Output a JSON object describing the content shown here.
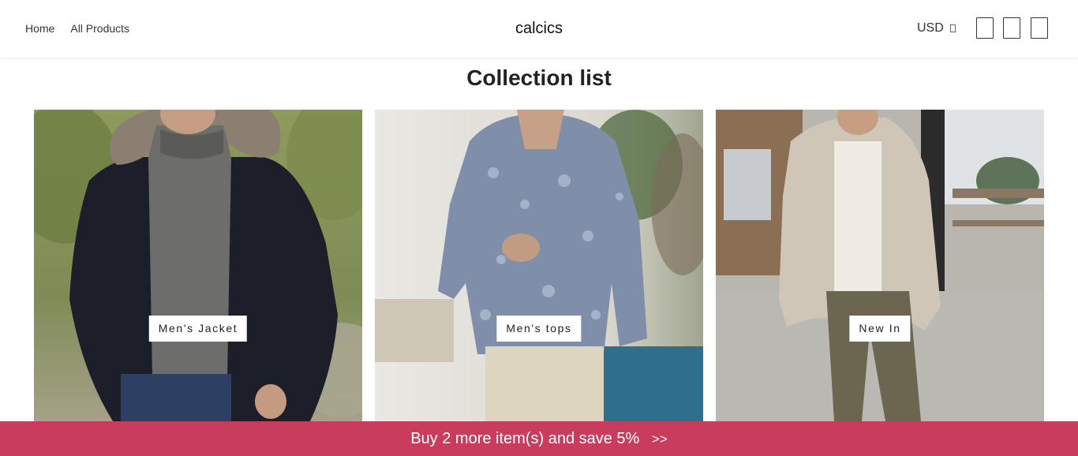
{
  "header": {
    "nav": [
      {
        "label": "Home"
      },
      {
        "label": "All Products"
      }
    ],
    "brand": "calcics",
    "currency": {
      "label": "USD"
    },
    "icons": [
      "search-icon",
      "account-icon",
      "cart-icon"
    ]
  },
  "main": {
    "title": "Collection list",
    "collections": [
      {
        "label": "Men's Jacket"
      },
      {
        "label": "Men's tops"
      },
      {
        "label": "New In"
      }
    ]
  },
  "promo_bar": {
    "text": "Buy 2 more item(s) and save 5%",
    "arrows": ">>",
    "background": "#c93c5d"
  }
}
